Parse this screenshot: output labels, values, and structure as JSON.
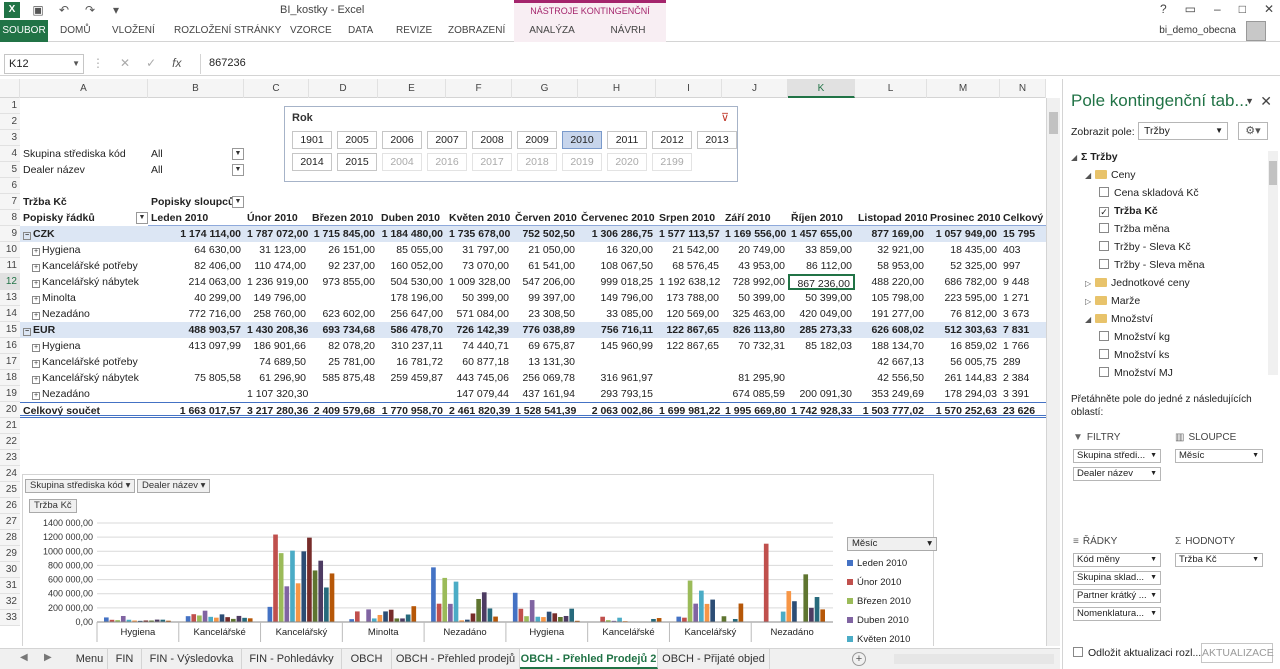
{
  "window": {
    "title": "BI_kostky - Excel",
    "context_group": "NÁSTROJE KONTINGENČNÍ TABULKY",
    "user": "bi_demo_obecna"
  },
  "ribbon": {
    "tabs": [
      "SOUBOR",
      "DOMŮ",
      "VLOŽENÍ",
      "ROZLOŽENÍ STRÁNKY",
      "VZORCE",
      "DATA",
      "REVIZE",
      "ZOBRAZENÍ",
      "ANALÝZA",
      "NÁVRH"
    ]
  },
  "formula": {
    "name_box": "K12",
    "value": "867236"
  },
  "columns": [
    "A",
    "B",
    "C",
    "D",
    "E",
    "F",
    "G",
    "H",
    "I",
    "J",
    "K",
    "L",
    "M",
    "N"
  ],
  "rows": [
    "1",
    "2",
    "3",
    "4",
    "5",
    "6",
    "7",
    "8",
    "9",
    "10",
    "11",
    "12",
    "13",
    "14",
    "15",
    "16",
    "17",
    "18",
    "19",
    "20",
    "21",
    "22",
    "23",
    "24",
    "25",
    "26",
    "27",
    "28",
    "29",
    "30",
    "31",
    "32",
    "33"
  ],
  "filters": [
    {
      "label": "Skupina střediska kód",
      "value": "All"
    },
    {
      "label": "Dealer název",
      "value": "All"
    }
  ],
  "slicer": {
    "title": "Rok",
    "items": [
      "1901",
      "2005",
      "2006",
      "2007",
      "2008",
      "2009",
      "2010",
      "2011",
      "2012",
      "2013",
      "2014",
      "2015",
      "2004",
      "2016",
      "2017",
      "2018",
      "2019",
      "2020",
      "2199"
    ],
    "selected": "2010"
  },
  "pivot": {
    "corner": "Tržba Kč",
    "col_caption": "Popisky sloupců",
    "row_caption": "Popisky řádků",
    "months": [
      "Leden 2010",
      "Únor 2010",
      "Březen 2010",
      "Duben 2010",
      "Květen 2010",
      "Červen 2010",
      "Červenec 2010",
      "Srpen 2010",
      "Září 2010",
      "Říjen 2010",
      "Listopad 2010",
      "Prosinec 2010",
      "Celkový"
    ],
    "rows": [
      {
        "label": "CZK",
        "level": 0,
        "values": [
          "1 174 114,00",
          "1 787 072,00",
          "1 715 845,00",
          "1 184 480,00",
          "1 735 678,00",
          "752 502,50",
          "1 306 286,75",
          "1 577 113,57",
          "1 169 556,00",
          "1 457 655,00",
          "877 169,00",
          "1 057 949,00",
          "15 795"
        ]
      },
      {
        "label": "Hygiena",
        "level": 1,
        "values": [
          "64 630,00",
          "31 123,00",
          "26 151,00",
          "85 055,00",
          "31 797,00",
          "21 050,00",
          "16 320,00",
          "21 542,00",
          "20 749,00",
          "33 859,00",
          "32 921,00",
          "18 435,00",
          "403"
        ]
      },
      {
        "label": "Kancelářské potřeby",
        "level": 1,
        "values": [
          "82 406,00",
          "110 474,00",
          "92 237,00",
          "160 052,00",
          "73 070,00",
          "61 541,00",
          "108 067,50",
          "68 576,45",
          "43 953,00",
          "86 112,00",
          "58 953,00",
          "52 325,00",
          "997"
        ]
      },
      {
        "label": "Kancelářský nábytek",
        "level": 1,
        "values": [
          "214 063,00",
          "1 236 919,00",
          "973 855,00",
          "504 530,00",
          "1 009 328,00",
          "547 206,00",
          "999 018,25",
          "1 192 638,12",
          "728 992,00",
          "867 236,00",
          "488 220,00",
          "686 782,00",
          "9 448"
        ]
      },
      {
        "label": "Minolta",
        "level": 1,
        "values": [
          "40 299,00",
          "149 796,00",
          "",
          "178 196,00",
          "50 399,00",
          "99 397,00",
          "149 796,00",
          "173 788,00",
          "50 399,00",
          "50 399,00",
          "105 798,00",
          "223 595,00",
          "1 271"
        ]
      },
      {
        "label": "Nezadáno",
        "level": 1,
        "values": [
          "772 716,00",
          "258 760,00",
          "623 602,00",
          "256 647,00",
          "571 084,00",
          "23 308,50",
          "33 085,00",
          "120 569,00",
          "325 463,00",
          "420 049,00",
          "191 277,00",
          "76 812,00",
          "3 673"
        ]
      },
      {
        "label": "EUR",
        "level": 0,
        "values": [
          "488 903,57",
          "1 430 208,36",
          "693 734,68",
          "586 478,70",
          "726 142,39",
          "776 038,89",
          "756 716,11",
          "122 867,65",
          "826 113,80",
          "285 273,33",
          "626 608,02",
          "512 303,63",
          "7 831"
        ]
      },
      {
        "label": "Hygiena",
        "level": 1,
        "values": [
          "413 097,99",
          "186 901,66",
          "82 078,20",
          "310 237,11",
          "74 440,71",
          "69 675,87",
          "145 960,99",
          "122 867,65",
          "70 732,31",
          "85 182,03",
          "188 134,70",
          "16 859,02",
          "1 766"
        ]
      },
      {
        "label": "Kancelářské potřeby",
        "level": 1,
        "values": [
          "",
          "74 689,50",
          "25 781,00",
          "16 781,72",
          "60 877,18",
          "13 131,30",
          "",
          "",
          "",
          "",
          "42 667,13",
          "56 005,75",
          "289"
        ]
      },
      {
        "label": "Kancelářský nábytek",
        "level": 1,
        "values": [
          "75 805,58",
          "61 296,90",
          "585 875,48",
          "259 459,87",
          "443 745,06",
          "256 069,78",
          "316 961,97",
          "",
          "81 295,90",
          "",
          "42 556,50",
          "261 144,83",
          "2 384"
        ]
      },
      {
        "label": "Nezadáno",
        "level": 1,
        "values": [
          "",
          "1 107 320,30",
          "",
          "",
          "147 079,44",
          "437 161,94",
          "293 793,15",
          "",
          "674 085,59",
          "200 091,30",
          "353 249,69",
          "178 294,03",
          "3 391"
        ]
      },
      {
        "label": "Celkový součet",
        "level": -1,
        "values": [
          "1 663 017,57",
          "3 217 280,36",
          "2 409 579,68",
          "1 770 958,70",
          "2 461 820,39",
          "1 528 541,39",
          "2 063 002,86",
          "1 699 981,22",
          "1 995 669,80",
          "1 742 928,33",
          "1 503 777,02",
          "1 570 252,63",
          "23 626"
        ]
      }
    ]
  },
  "chart_data": {
    "type": "bar",
    "filter_buttons": [
      "Skupina střediska kód",
      "Dealer název"
    ],
    "value_button": "Tržba Kč",
    "legend_title": "Měsíc",
    "ylim": [
      0,
      1400000
    ],
    "yticks": [
      "1400 000,00",
      "1200 000,00",
      "1000 000,00",
      "800 000,00",
      "600 000,00",
      "400 000,00",
      "200 000,00",
      "0,00"
    ],
    "categories": [
      "Hygiena",
      "Kancelářské",
      "Kancelářský",
      "Minolta",
      "Nezadáno",
      "Hygiena",
      "Kancelářské",
      "Kancelářský",
      "Nezadáno"
    ],
    "series": [
      {
        "name": "Leden 2010",
        "color": "#4472c4",
        "values": [
          64630,
          82406,
          214063,
          40299,
          772716,
          413098,
          0,
          75806,
          0
        ]
      },
      {
        "name": "Únor 2010",
        "color": "#c0504d",
        "values": [
          31123,
          110474,
          1236919,
          149796,
          258760,
          186902,
          74690,
          61297,
          1107320
        ]
      },
      {
        "name": "Březen 2010",
        "color": "#9bbb59",
        "values": [
          26151,
          92237,
          973855,
          0,
          623602,
          82078,
          25781,
          585875,
          0
        ]
      },
      {
        "name": "Duben 2010",
        "color": "#8064a2",
        "values": [
          85055,
          160052,
          504530,
          178196,
          256647,
          310237,
          16782,
          259460,
          0
        ]
      },
      {
        "name": "Květen 2010",
        "color": "#4bacc6",
        "values": [
          31797,
          73070,
          1009328,
          50399,
          571084,
          74441,
          60877,
          443745,
          147079
        ]
      },
      {
        "name": "Červen 2010",
        "color": "#f79646",
        "values": [
          21050,
          61541,
          547206,
          99397,
          23309,
          69676,
          13131,
          256070,
          437162
        ]
      },
      {
        "name": "Červenec 2010",
        "color": "#2c4d75",
        "values": [
          16320,
          108068,
          999018,
          149796,
          33085,
          145961,
          0,
          316962,
          293793
        ]
      },
      {
        "name": "Srpen 2010",
        "color": "#772c2a",
        "values": [
          21542,
          68576,
          1192638,
          173788,
          120569,
          122868,
          0,
          0,
          0
        ]
      },
      {
        "name": "Září 2010",
        "color": "#5f7530",
        "values": [
          20749,
          43953,
          728992,
          50399,
          325463,
          70732,
          0,
          81296,
          674086
        ]
      },
      {
        "name": "Říjen 2010",
        "color": "#4d3b62",
        "values": [
          33859,
          86112,
          867236,
          50399,
          420049,
          85182,
          0,
          0,
          200091
        ]
      },
      {
        "name": "Listopad 2010",
        "color": "#276a7c",
        "values": [
          32921,
          58953,
          488220,
          105798,
          191277,
          188135,
          42667,
          42557,
          353250
        ]
      },
      {
        "name": "Prosinec 2010",
        "color": "#b65708",
        "values": [
          18435,
          52325,
          686782,
          223595,
          76812,
          16859,
          56006,
          261145,
          178294
        ]
      }
    ],
    "legend_visible": [
      "Leden 2010",
      "Únor 2010",
      "Březen 2010",
      "Duben 2010",
      "Květen 2010"
    ]
  },
  "sheets": [
    "Menu",
    "FIN",
    "FIN - Výsledovka",
    "FIN - Pohledávky",
    "OBCH",
    "OBCH - Přehled prodejů",
    "OBCH - Přehled Prodejů 2",
    "OBCH - Přijaté objed"
  ],
  "active_sheet": "OBCH - Přehled Prodejů 2",
  "fieldlist": {
    "title": "Pole kontingenční tab...",
    "show_label": "Zobrazit pole:",
    "show_value": "Tržby",
    "tree": [
      {
        "label": "Tržby",
        "type": "measure-group",
        "indent": 0
      },
      {
        "label": "Ceny",
        "type": "folder-open",
        "indent": 1
      },
      {
        "label": "Cena skladová Kč",
        "type": "field",
        "checked": false,
        "indent": 2
      },
      {
        "label": "Tržba Kč",
        "type": "field",
        "checked": true,
        "indent": 2
      },
      {
        "label": "Tržba měna",
        "type": "field",
        "checked": false,
        "indent": 2
      },
      {
        "label": "Tržby - Sleva Kč",
        "type": "field",
        "checked": false,
        "indent": 2
      },
      {
        "label": "Tržby - Sleva měna",
        "type": "field",
        "checked": false,
        "indent": 2
      },
      {
        "label": "Jednotkové ceny",
        "type": "folder",
        "indent": 1
      },
      {
        "label": "Marže",
        "type": "folder",
        "indent": 1
      },
      {
        "label": "Množství",
        "type": "folder-open",
        "indent": 1
      },
      {
        "label": "Množství kg",
        "type": "field",
        "checked": false,
        "indent": 2
      },
      {
        "label": "Množství ks",
        "type": "field",
        "checked": false,
        "indent": 2
      },
      {
        "label": "Množství MJ",
        "type": "field",
        "checked": false,
        "indent": 2
      }
    ],
    "drag_hint": "Přetáhněte pole do jedné z následujících oblastí:",
    "areas": {
      "filters": {
        "title": "FILTRY",
        "items": [
          "Skupina středi...",
          "Dealer název"
        ]
      },
      "columns": {
        "title": "SLOUPCE",
        "items": [
          "Měsíc"
        ]
      },
      "rows": {
        "title": "ŘÁDKY",
        "items": [
          "Kód měny",
          "Skupina sklad...",
          "Partner krátký ...",
          "Nomenklatura..."
        ]
      },
      "values": {
        "title": "HODNOTY",
        "items": [
          "Tržba Kč"
        ]
      }
    },
    "defer_label": "Odložit aktualizaci rozl...",
    "update_label": "AKTUALIZACE"
  }
}
